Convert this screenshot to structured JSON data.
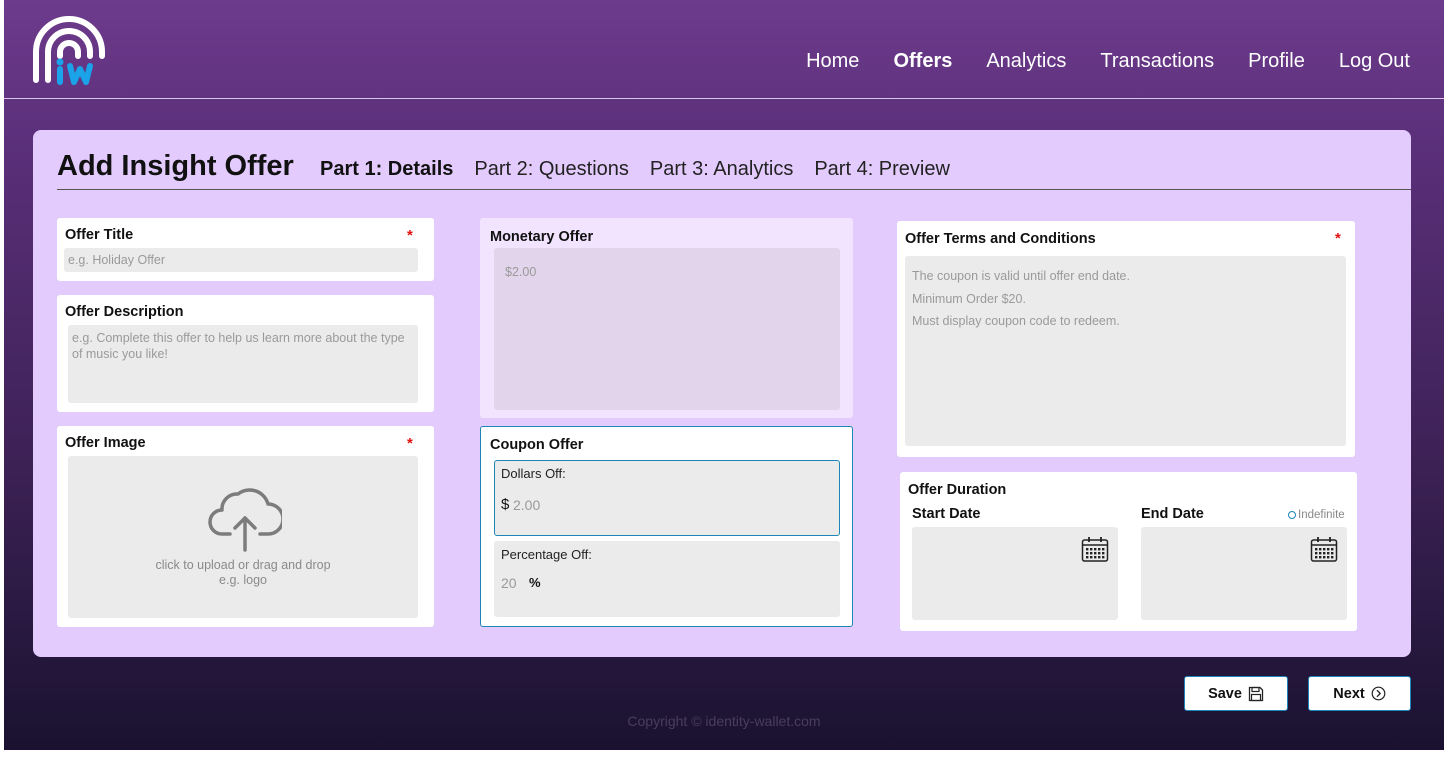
{
  "app": {
    "logo_text": "iw"
  },
  "nav": [
    "Home",
    "Offers",
    "Analytics",
    "Transactions",
    "Profile",
    "Log Out"
  ],
  "nav_active": "Offers",
  "page": {
    "title": "Add Insight Offer",
    "tabs": [
      "Part 1: Details",
      "Part 2: Questions",
      "Part 3: Analytics",
      "Part 4: Preview"
    ],
    "active_tab": "Part 1: Details"
  },
  "offer_title": {
    "label": "Offer Title",
    "required": "*",
    "placeholder": "e.g. Holiday Offer"
  },
  "offer_description": {
    "label": "Offer Description",
    "placeholder": "e.g. Complete this offer to help us learn more about the type of music you like!"
  },
  "offer_image": {
    "label": "Offer Image",
    "required": "*",
    "upload_line1": "click to upload or drag and drop",
    "upload_line2": "e.g. logo",
    "icon": "cloud-upload-icon"
  },
  "monetary_offer": {
    "label": "Monetary Offer",
    "placeholder": "$2.00"
  },
  "coupon_offer": {
    "label": "Coupon Offer",
    "dollars_label": "Dollars Off:",
    "dollars_symbol": "$",
    "dollars_placeholder": "2.00",
    "percentage_label": "Percentage Off:",
    "percentage_placeholder": "20",
    "percentage_symbol": "%"
  },
  "terms": {
    "label": "Offer Terms and Conditions",
    "required": "*",
    "lines": [
      "The coupon is valid until offer end date.",
      "Minimum Order $20.",
      "Must display coupon code to redeem."
    ]
  },
  "duration": {
    "label": "Offer Duration",
    "start_label": "Start Date",
    "end_label": "End Date",
    "indefinite_label": "Indefinite"
  },
  "buttons": {
    "save": "Save",
    "next": "Next"
  },
  "footer": {
    "copyright": "Copyright © identity-wallet.com"
  },
  "colors": {
    "accent": "#1d86b8",
    "required": "#e01010",
    "card": "#e3cbfd",
    "logo_blue": "#1aa3e8"
  }
}
